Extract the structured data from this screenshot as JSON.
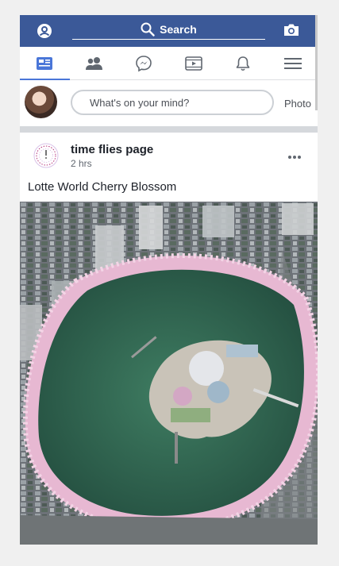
{
  "topbar": {
    "search_label": "Search",
    "background_color": "#3b5998",
    "icons": [
      "profile-icon",
      "search-icon",
      "camera-icon"
    ]
  },
  "nav": {
    "tabs": [
      {
        "name": "news-feed",
        "icon": "news-feed-icon",
        "active": true
      },
      {
        "name": "friends",
        "icon": "friends-icon",
        "active": false
      },
      {
        "name": "messenger",
        "icon": "messenger-icon",
        "active": false
      },
      {
        "name": "watch",
        "icon": "video-icon",
        "active": false
      },
      {
        "name": "notifications",
        "icon": "bell-icon",
        "active": false
      },
      {
        "name": "menu",
        "icon": "hamburger-menu-icon",
        "active": false
      }
    ],
    "active_color": "#4a76d8"
  },
  "composer": {
    "placeholder": "What's on your mind?",
    "photo_label": "Photo"
  },
  "post": {
    "page_name": "time flies page",
    "timestamp": "2 hrs",
    "caption": "Lotte World Cherry Blossom",
    "photo_icon": "aerial-photo"
  }
}
